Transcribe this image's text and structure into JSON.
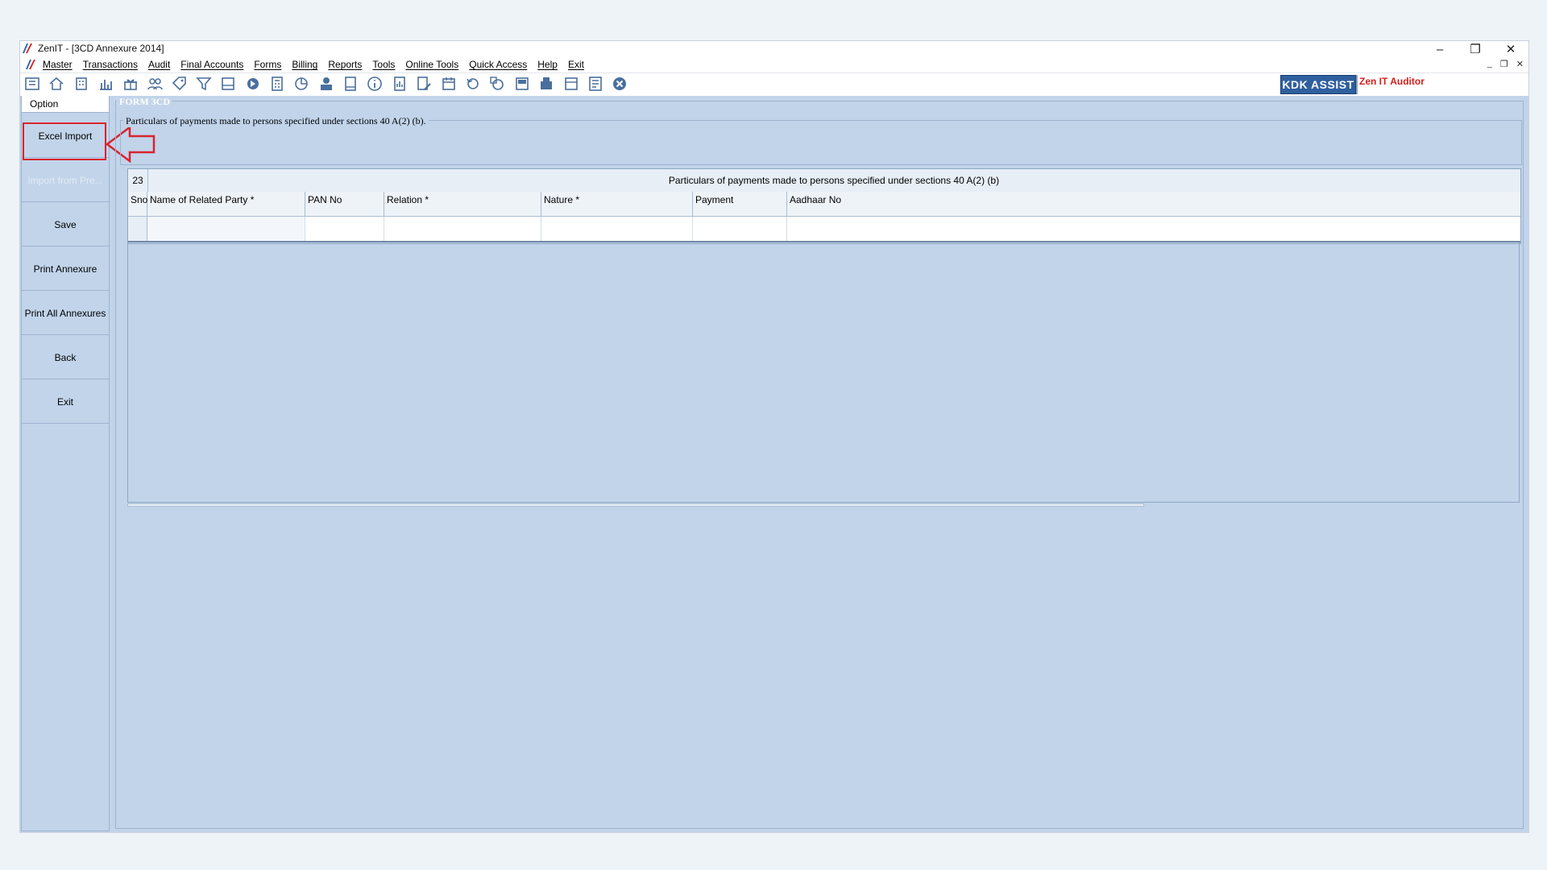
{
  "window": {
    "title": "ZenIT - [3CD Annexure 2014]",
    "controls": {
      "minimize": "–",
      "restore": "❐",
      "close": "✕"
    },
    "mdi_controls": {
      "minimize": "_",
      "restore": "❐",
      "close": "✕"
    }
  },
  "menu": {
    "items": [
      "Master",
      "Transactions",
      "Audit",
      "Final Accounts",
      "Forms",
      "Billing",
      "Reports",
      "Tools",
      "Online Tools",
      "Quick Access",
      "Help",
      "Exit"
    ]
  },
  "toolbar": {
    "icons": [
      "ledger-icon",
      "home-icon",
      "building-icon",
      "bar-chart-icon",
      "gift-icon",
      "users-icon",
      "tag-icon",
      "filter-icon",
      "tax-icon",
      "forward-icon",
      "calculator-icon",
      "pie-chart-icon",
      "pay-icon",
      "book-icon",
      "info-icon",
      "report-icon",
      "edit-document-icon",
      "calendar-icon",
      "cycle-icon",
      "refresh-icon",
      "bs-icon",
      "bs-building-icon",
      "3cd-icon",
      "form-icon",
      "close-circle-icon"
    ],
    "kdk_assist": "KDK ASSIST",
    "zen_auditor": "Zen IT Auditor"
  },
  "side_panel": {
    "header": "Option",
    "buttons": [
      {
        "label": "Excel Import",
        "enabled": true
      },
      {
        "label": "Import from Pre...",
        "enabled": false
      },
      {
        "label": "Save",
        "enabled": true
      },
      {
        "label": "Print Annexure",
        "enabled": true
      },
      {
        "label": "Print All Annexures",
        "enabled": true
      },
      {
        "label": "Back",
        "enabled": true
      },
      {
        "label": "Exit",
        "enabled": true
      }
    ]
  },
  "form": {
    "legend": "FORM 3CD",
    "section_title": "Particulars of payments made to persons specified under sections 40 A(2) (b).",
    "grid": {
      "number": "23",
      "title": "Particulars of payments made to persons specified under sections 40 A(2) (b)",
      "columns": [
        "Sno",
        "Name of Related Party *",
        "PAN No",
        "Relation *",
        "Nature *",
        "Payment",
        "Aadhaar No"
      ],
      "rows": [
        [
          "",
          "",
          "",
          "",
          "",
          "",
          ""
        ]
      ]
    }
  },
  "colors": {
    "accent_highlight": "#d9232e",
    "panel_bg": "#c1d4ea",
    "kdk_bg": "#2f5f9e",
    "zen_red": "#d6201b"
  }
}
